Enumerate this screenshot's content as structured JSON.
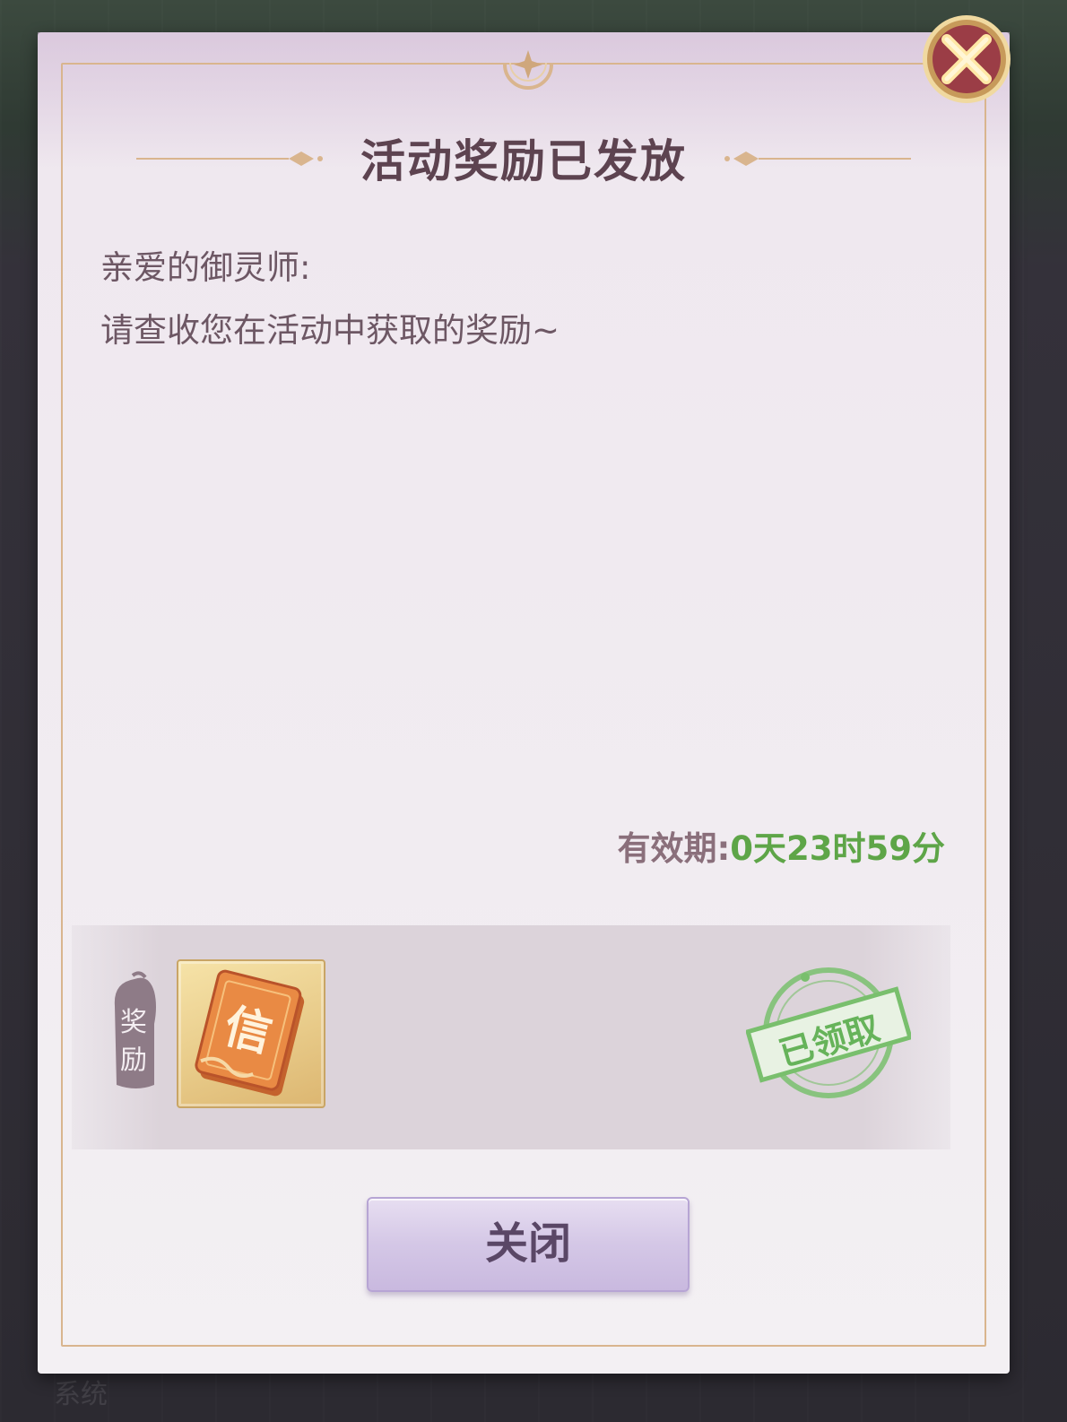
{
  "dialog": {
    "title": "活动奖励已发放",
    "greeting": "亲爱的御灵师:",
    "body": "请查收您在活动中获取的奖励~",
    "validity_label": "有效期:",
    "validity_value": "0天23时59分",
    "close_button_label": "关闭",
    "close_icon": "close-x-icon"
  },
  "reward": {
    "tag_line1": "奖",
    "tag_line2": "励",
    "item_glyph": "信",
    "item_icon": "letter-card-icon",
    "status_stamp": "已领取"
  },
  "background": {
    "faint_text": "系统"
  },
  "colors": {
    "title": "#5d4350",
    "validity_value": "#5ea548",
    "stamp": "#66b35a",
    "frame": "#d9b58e",
    "button": "#d4c7e6"
  }
}
